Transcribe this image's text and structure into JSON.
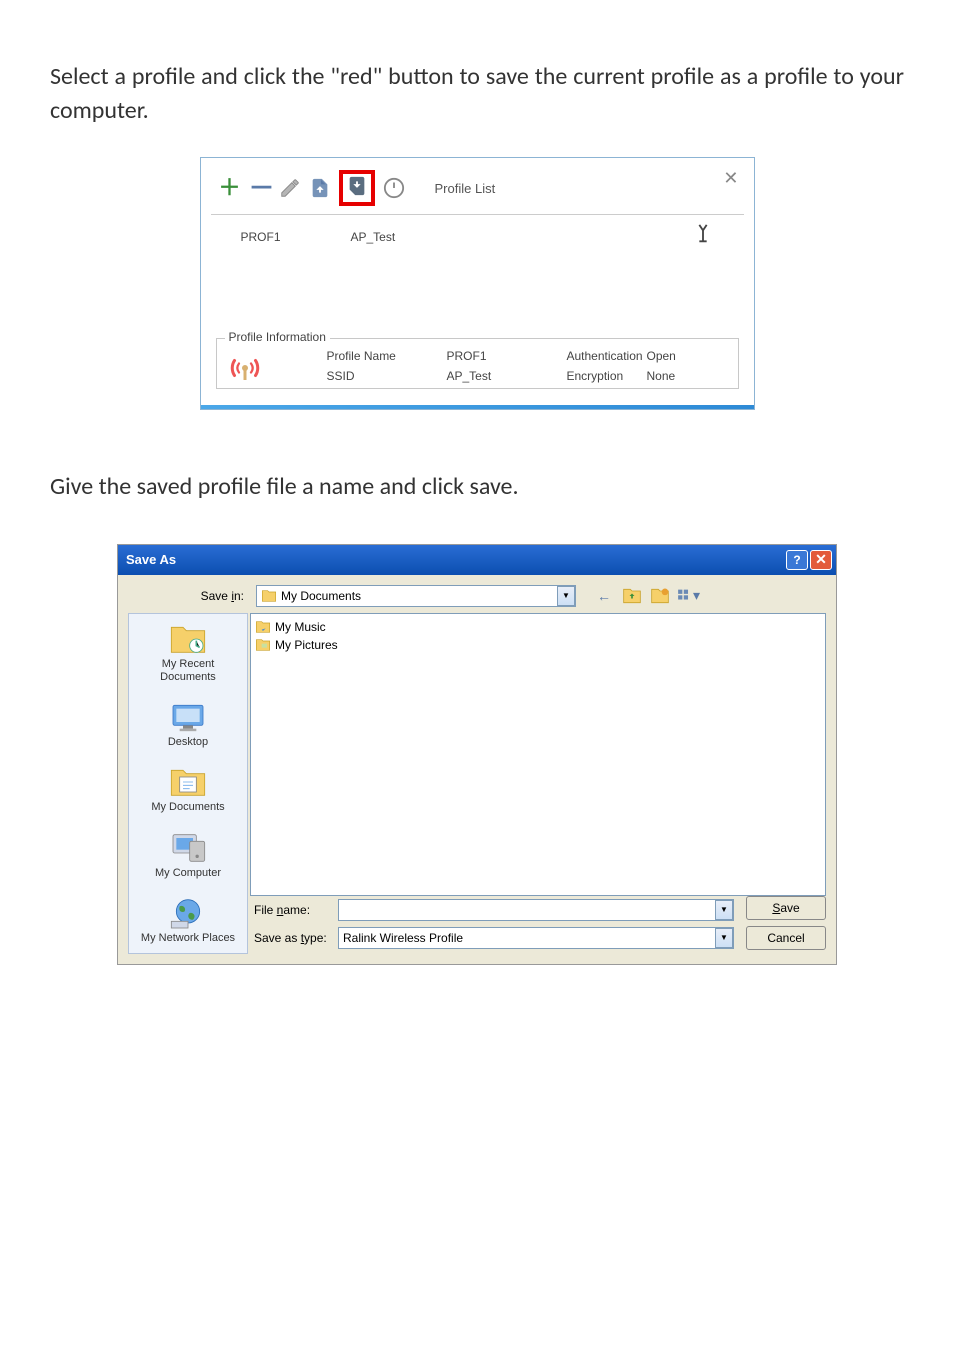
{
  "instruction1": "Select a profile and click the \"red\" button to save the current profile as a profile to your computer.",
  "instruction2": "Give the saved profile file a name and click save.",
  "profile_panel": {
    "title": "Profile List",
    "close_x": "✕",
    "row": {
      "name": "PROF1",
      "ssid": "AP_Test"
    },
    "info": {
      "legend": "Profile Information",
      "labels": {
        "profile_name": "Profile Name",
        "ssid": "SSID",
        "authentication": "Authentication",
        "encryption": "Encryption"
      },
      "values": {
        "profile_name": "PROF1",
        "ssid": "AP_Test",
        "authentication": "Open",
        "encryption": "None"
      }
    }
  },
  "save_dialog": {
    "title": "Save As",
    "save_in_label": "Save in:",
    "save_in_value": "My Documents",
    "file_items": [
      "My Music",
      "My Pictures"
    ],
    "places": {
      "recent": "My Recent Documents",
      "desktop": "Desktop",
      "mydocs": "My Documents",
      "mycomp": "My Computer",
      "mynet": "My Network Places"
    },
    "file_name_label": "File name:",
    "file_name_value": "",
    "save_type_label": "Save as type:",
    "save_type_value": "Ralink Wireless Profile",
    "save_btn": "Save",
    "cancel_btn": "Cancel"
  }
}
